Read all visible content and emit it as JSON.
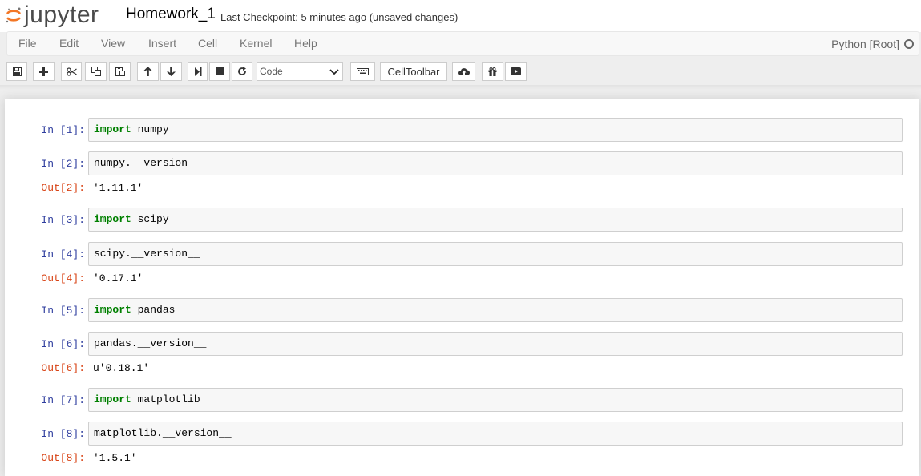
{
  "header": {
    "logo_text": "jupyter",
    "notebook_name": "Homework_1",
    "checkpoint": "Last Checkpoint: 5 minutes ago (unsaved changes)"
  },
  "menu": {
    "items": [
      "File",
      "Edit",
      "View",
      "Insert",
      "Cell",
      "Kernel",
      "Help"
    ],
    "kernel_name": "Python [Root]"
  },
  "toolbar": {
    "cell_type": "Code",
    "celltoolbar_label": "CellToolbar",
    "icons": [
      "save-icon",
      "plus-icon",
      "cut-icon",
      "copy-icon",
      "paste-icon",
      "arrow-up-icon",
      "arrow-down-icon",
      "step-forward-icon",
      "stop-icon",
      "restart-icon",
      "keyboard-icon",
      "cloud-upload-icon",
      "gift-icon",
      "youtube-icon"
    ]
  },
  "cells": [
    {
      "prompt": "In [1]:",
      "keyword": "import",
      "code": " numpy"
    },
    {
      "prompt": "In [2]:",
      "keyword": "",
      "code": "numpy.__version__",
      "out_prompt": "Out[2]:",
      "output": "'1.11.1'"
    },
    {
      "prompt": "In [3]:",
      "keyword": "import",
      "code": " scipy"
    },
    {
      "prompt": "In [4]:",
      "keyword": "",
      "code": "scipy.__version__",
      "out_prompt": "Out[4]:",
      "output": "'0.17.1'"
    },
    {
      "prompt": "In [5]:",
      "keyword": "import",
      "code": " pandas"
    },
    {
      "prompt": "In [6]:",
      "keyword": "",
      "code": "pandas.__version__",
      "out_prompt": "Out[6]:",
      "output": "u'0.18.1'"
    },
    {
      "prompt": "In [7]:",
      "keyword": "import",
      "code": " matplotlib"
    },
    {
      "prompt": "In [8]:",
      "keyword": "",
      "code": "matplotlib.__version__",
      "out_prompt": "Out[8]:",
      "output": "'1.5.1'"
    }
  ],
  "colors": {
    "keyword": "#008000",
    "in_prompt": "#303f9f",
    "out_prompt": "#d84315",
    "logo_orange": "#f37726"
  }
}
